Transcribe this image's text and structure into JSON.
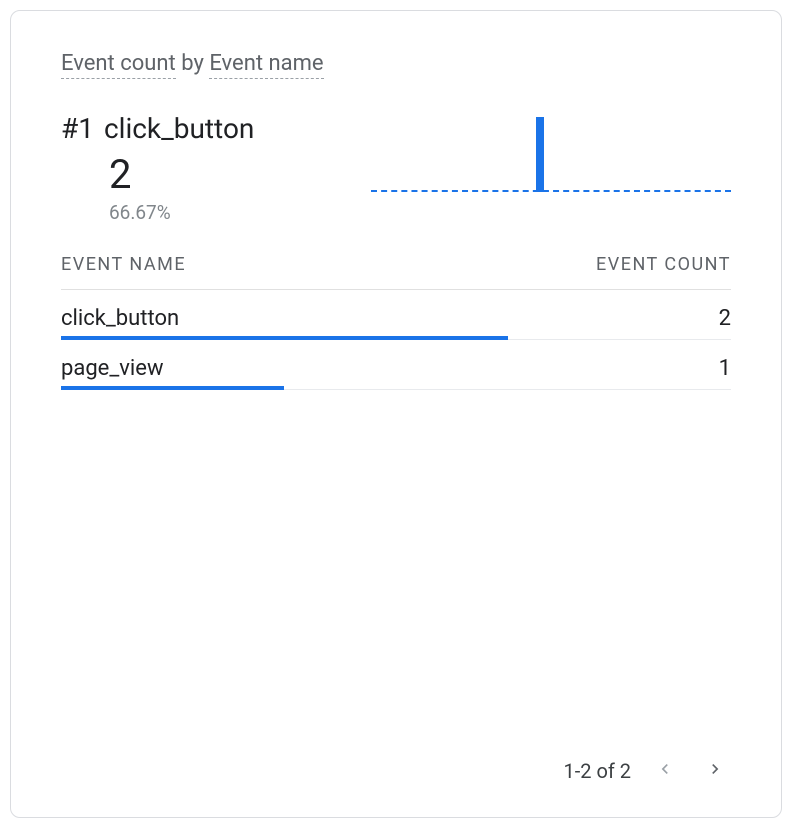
{
  "card": {
    "title_metric": "Event count",
    "title_by": " by ",
    "title_dimension": "Event name",
    "top_item": {
      "rank": "#1",
      "name": "click_button",
      "value": "2",
      "percent": "66.67%"
    },
    "table": {
      "col_name": "EVENT NAME",
      "col_count": "EVENT COUNT",
      "rows": [
        {
          "name": "click_button",
          "count": "2",
          "bar_pct": 66.67
        },
        {
          "name": "page_view",
          "count": "1",
          "bar_pct": 33.33
        }
      ]
    },
    "pager": {
      "label": "1-2 of 2"
    }
  },
  "chart_data": {
    "type": "bar",
    "title": "Event count by Event name",
    "xlabel": "Event name",
    "ylabel": "Event count",
    "categories": [
      "click_button",
      "page_view"
    ],
    "values": [
      2,
      1
    ],
    "ylim": [
      0,
      2
    ]
  }
}
